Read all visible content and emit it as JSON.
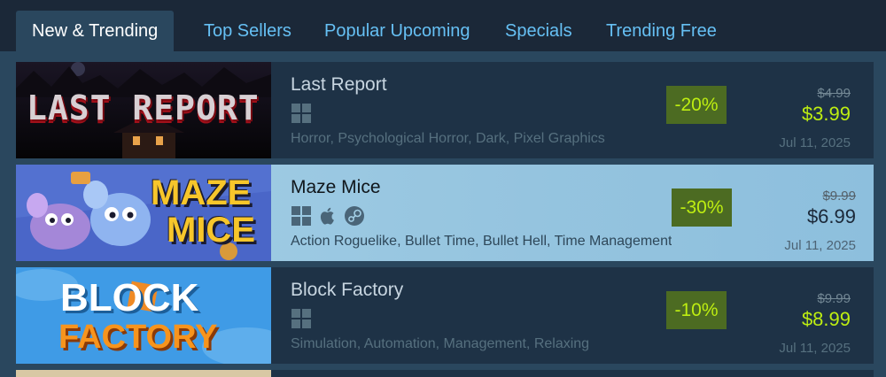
{
  "tabs": [
    {
      "label": "New & Trending",
      "active": true
    },
    {
      "label": "Top Sellers",
      "active": false
    },
    {
      "label": "Popular Upcoming",
      "active": false
    },
    {
      "label": "Specials",
      "active": false
    },
    {
      "label": "Trending Free",
      "active": false
    }
  ],
  "colors": {
    "background": "#1b2838",
    "panel": "#2a475e",
    "row": "#1e3246",
    "row_hover": "#a3cfe6",
    "accent_link": "#66c0f4",
    "discount_bg": "#4c6b22",
    "discount_text": "#beee11"
  },
  "games": [
    {
      "title": "Last Report",
      "capsule_text": "LAST REPORT",
      "platforms": [
        "windows-icon"
      ],
      "tags": "Horror, Psychological Horror, Dark, Pixel Graphics",
      "discount": "-20%",
      "original_price": "$4.99",
      "final_price": "$3.99",
      "date": "Jul 11, 2025",
      "highlighted": false
    },
    {
      "title": "Maze Mice",
      "capsule_text_1": "MAZE",
      "capsule_text_2": "MICE",
      "platforms": [
        "windows-icon",
        "apple-icon",
        "steam-icon"
      ],
      "tags": "Action Roguelike, Bullet Time, Bullet Hell, Time Management",
      "discount": "-30%",
      "original_price": "$9.99",
      "final_price": "$6.99",
      "date": "Jul 11, 2025",
      "highlighted": true
    },
    {
      "title": "Block Factory",
      "capsule_text_1": "BLOCK",
      "capsule_text_2": "FACTORY",
      "platforms": [
        "windows-icon"
      ],
      "tags": "Simulation, Automation, Management, Relaxing",
      "discount": "-10%",
      "original_price": "$9.99",
      "final_price": "$8.99",
      "date": "Jul 11, 2025",
      "highlighted": false
    }
  ]
}
